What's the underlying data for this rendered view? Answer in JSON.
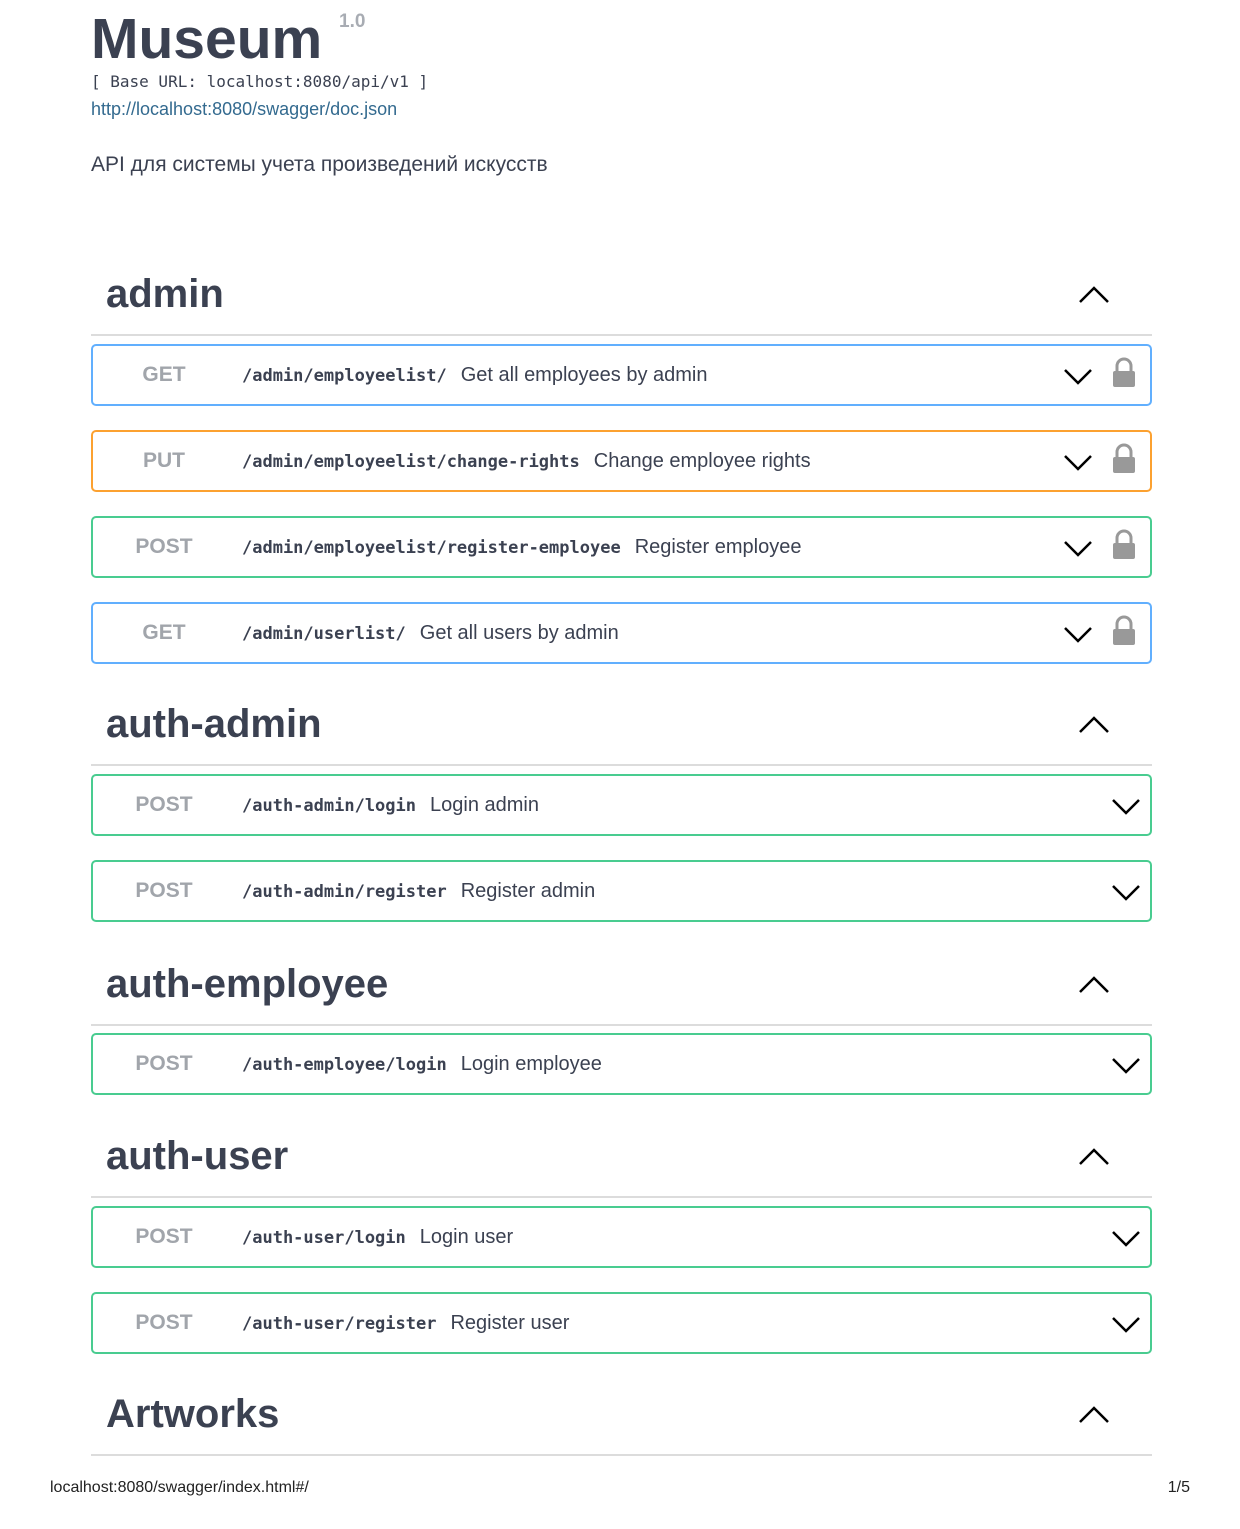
{
  "info": {
    "title": "Museum",
    "version": "1.0",
    "base_url": "[ Base URL: localhost:8080/api/v1 ]",
    "doc_link": "http://localhost:8080/swagger/doc.json",
    "description": "API для системы учета произведений искусств"
  },
  "sections": [
    {
      "name": "admin",
      "operations": [
        {
          "method": "GET",
          "path": "/admin/employeelist/",
          "summary": "Get all employees by admin",
          "locked": true
        },
        {
          "method": "PUT",
          "path": "/admin/employeelist/change-rights",
          "summary": "Change employee rights",
          "locked": true
        },
        {
          "method": "POST",
          "path": "/admin/employeelist/register-employee",
          "summary": "Register employee",
          "locked": true
        },
        {
          "method": "GET",
          "path": "/admin/userlist/",
          "summary": "Get all users by admin",
          "locked": true
        }
      ]
    },
    {
      "name": "auth-admin",
      "operations": [
        {
          "method": "POST",
          "path": "/auth-admin/login",
          "summary": "Login admin",
          "locked": false
        },
        {
          "method": "POST",
          "path": "/auth-admin/register",
          "summary": "Register admin",
          "locked": false
        }
      ]
    },
    {
      "name": "auth-employee",
      "operations": [
        {
          "method": "POST",
          "path": "/auth-employee/login",
          "summary": "Login employee",
          "locked": false
        }
      ]
    },
    {
      "name": "auth-user",
      "operations": [
        {
          "method": "POST",
          "path": "/auth-user/login",
          "summary": "Login user",
          "locked": false
        },
        {
          "method": "POST",
          "path": "/auth-user/register",
          "summary": "Register user",
          "locked": false
        }
      ]
    },
    {
      "name": "Artworks",
      "operations": []
    }
  ],
  "footer": {
    "url": "localhost:8080/swagger/index.html#/",
    "page": "1/5"
  },
  "colors": {
    "get": "#61affe",
    "put": "#fca130",
    "post": "#49cc90"
  }
}
